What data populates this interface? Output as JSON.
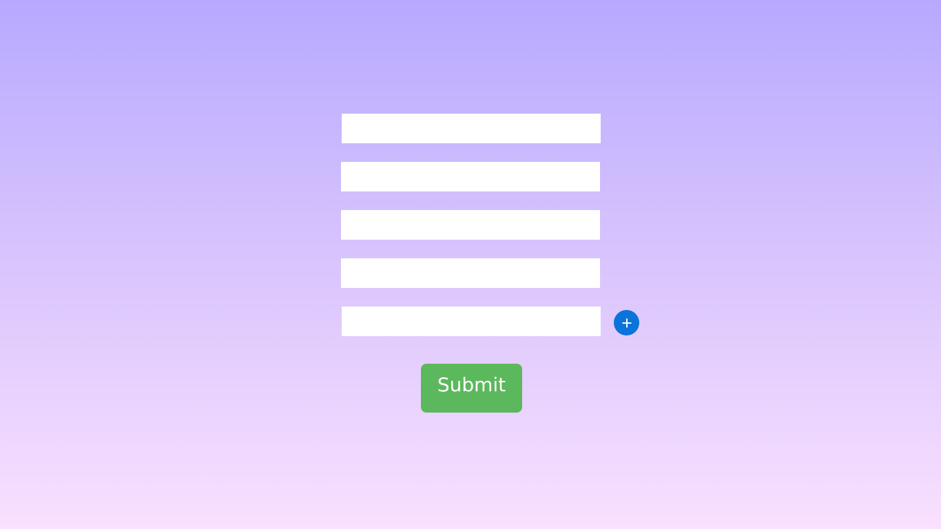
{
  "form": {
    "fields": [
      {
        "value": "",
        "placeholder": ""
      },
      {
        "value": "",
        "placeholder": ""
      },
      {
        "value": "",
        "placeholder": ""
      },
      {
        "value": "",
        "placeholder": ""
      },
      {
        "value": "",
        "placeholder": ""
      }
    ],
    "add_button": {
      "icon": "plus-icon",
      "color": "#0a74da"
    },
    "submit_label": "Submit",
    "submit_color": "#5cb85c"
  },
  "background": {
    "top_color": "#b8a9ff",
    "bottom_color": "#f9e0fe"
  }
}
